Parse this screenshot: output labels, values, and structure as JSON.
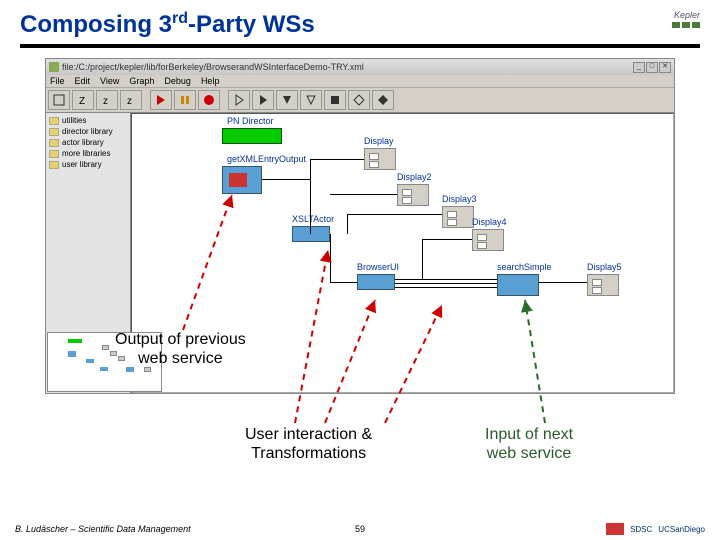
{
  "slide": {
    "title_prefix": "Composing 3",
    "title_super": "rd",
    "title_suffix": "-Party WSs",
    "kepler_label": "Kepler"
  },
  "window": {
    "path": "file:/C:/project/kepler/lib/forBerkeley/BrowserandWSInterfaceDemo-TRY.xml"
  },
  "menu": {
    "file": "File",
    "edit": "Edit",
    "view": "View",
    "graph": "Graph",
    "debug": "Debug",
    "help": "Help"
  },
  "sidebar": {
    "items": [
      {
        "label": "utilities"
      },
      {
        "label": "director library"
      },
      {
        "label": "actor library"
      },
      {
        "label": "more libraries"
      },
      {
        "label": "user library"
      }
    ]
  },
  "actors": {
    "director": "PN Director",
    "getxml": "getXMLEntryOutput",
    "xslt": "XSLTActor",
    "browser": "BrowserUI",
    "search": "searchSimple",
    "display": "Display",
    "display2": "Display2",
    "display3": "Display3",
    "display4": "Display4",
    "display5": "Display5"
  },
  "annotations": {
    "output_prev": "Output of previous\nweb service",
    "user_inter": "User interaction &\nTransformations",
    "input_next": "Input of next\nweb service"
  },
  "footer": {
    "author": "B. Ludäscher – Scientific Data Management",
    "page": "59",
    "sdsc": "SDSC",
    "ucsd": "UCSanDiego"
  }
}
